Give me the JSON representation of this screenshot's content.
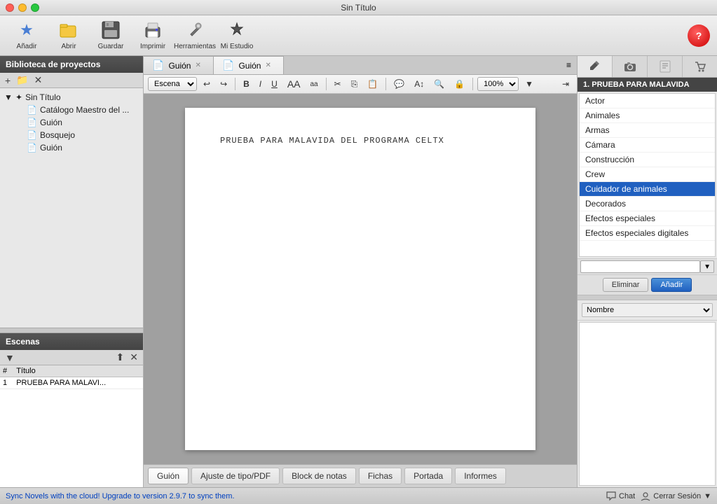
{
  "window": {
    "title": "Sin Título"
  },
  "toolbar": {
    "buttons": [
      {
        "id": "add",
        "label": "Añadir",
        "icon": "★"
      },
      {
        "id": "open",
        "label": "Abrir",
        "icon": "📁"
      },
      {
        "id": "save",
        "label": "Guardar",
        "icon": "💾"
      },
      {
        "id": "print",
        "label": "Imprimir",
        "icon": "🖨"
      },
      {
        "id": "tools",
        "label": "Herramientas",
        "icon": "🔧"
      },
      {
        "id": "studio",
        "label": "Mi Estudio",
        "icon": "◆"
      }
    ]
  },
  "sidebar": {
    "library_title": "Biblioteca de proyectos",
    "tree": [
      {
        "label": "Sin Título",
        "type": "project",
        "level": 0
      },
      {
        "label": "Catálogo Maestro del ...",
        "type": "doc",
        "level": 1
      },
      {
        "label": "Guión",
        "type": "doc",
        "level": 1
      },
      {
        "label": "Bosquejo",
        "type": "doc",
        "level": 1
      },
      {
        "label": "Guión",
        "type": "doc",
        "level": 1
      }
    ]
  },
  "scenes": {
    "title": "Escenas",
    "columns": [
      "#",
      "Título"
    ],
    "rows": [
      {
        "num": "1",
        "title": "PRUEBA PARA MALAVI..."
      }
    ]
  },
  "tabs": [
    {
      "label": "Guión",
      "active": false
    },
    {
      "label": "Guión",
      "active": true
    }
  ],
  "format_bar": {
    "scene_type": "Escena",
    "zoom": "100%"
  },
  "editor": {
    "content": "PRUEBA PARA MALAVIDA DEL PROGRAMA CELTX"
  },
  "bottom_tabs": [
    {
      "label": "Guión",
      "active": true
    },
    {
      "label": "Ajuste de tipo/PDF",
      "active": false
    },
    {
      "label": "Block de notas",
      "active": false
    },
    {
      "label": "Fichas",
      "active": false
    },
    {
      "label": "Portada",
      "active": false
    },
    {
      "label": "Informes",
      "active": false
    }
  ],
  "right_panel": {
    "section_title": "1. PRUEBA PARA MALAVIDA",
    "panel_tabs": [
      {
        "id": "pencil",
        "icon": "✏️"
      },
      {
        "id": "camera",
        "icon": "📷"
      },
      {
        "id": "script",
        "icon": "📋"
      },
      {
        "id": "cart",
        "icon": "🛒"
      }
    ],
    "list_items": [
      {
        "label": "Actor",
        "selected": false
      },
      {
        "label": "Animales",
        "selected": false
      },
      {
        "label": "Armas",
        "selected": false
      },
      {
        "label": "Cámara",
        "selected": false
      },
      {
        "label": "Construcción",
        "selected": false
      },
      {
        "label": "Crew",
        "selected": false
      },
      {
        "label": "Cuidador de animales",
        "selected": true
      },
      {
        "label": "Decorados",
        "selected": false
      },
      {
        "label": "Efectos especiales",
        "selected": false
      },
      {
        "label": "Efectos especiales digitales",
        "selected": false
      }
    ],
    "delete_label": "Eliminar",
    "add_label": "Añadir",
    "dropdown_label": "Nombre"
  },
  "status_bar": {
    "sync_text": "Sync Novels with the cloud! Upgrade to version 2.9.7 to sync them.",
    "chat_label": "Chat",
    "session_label": "Cerrar Sesión"
  }
}
